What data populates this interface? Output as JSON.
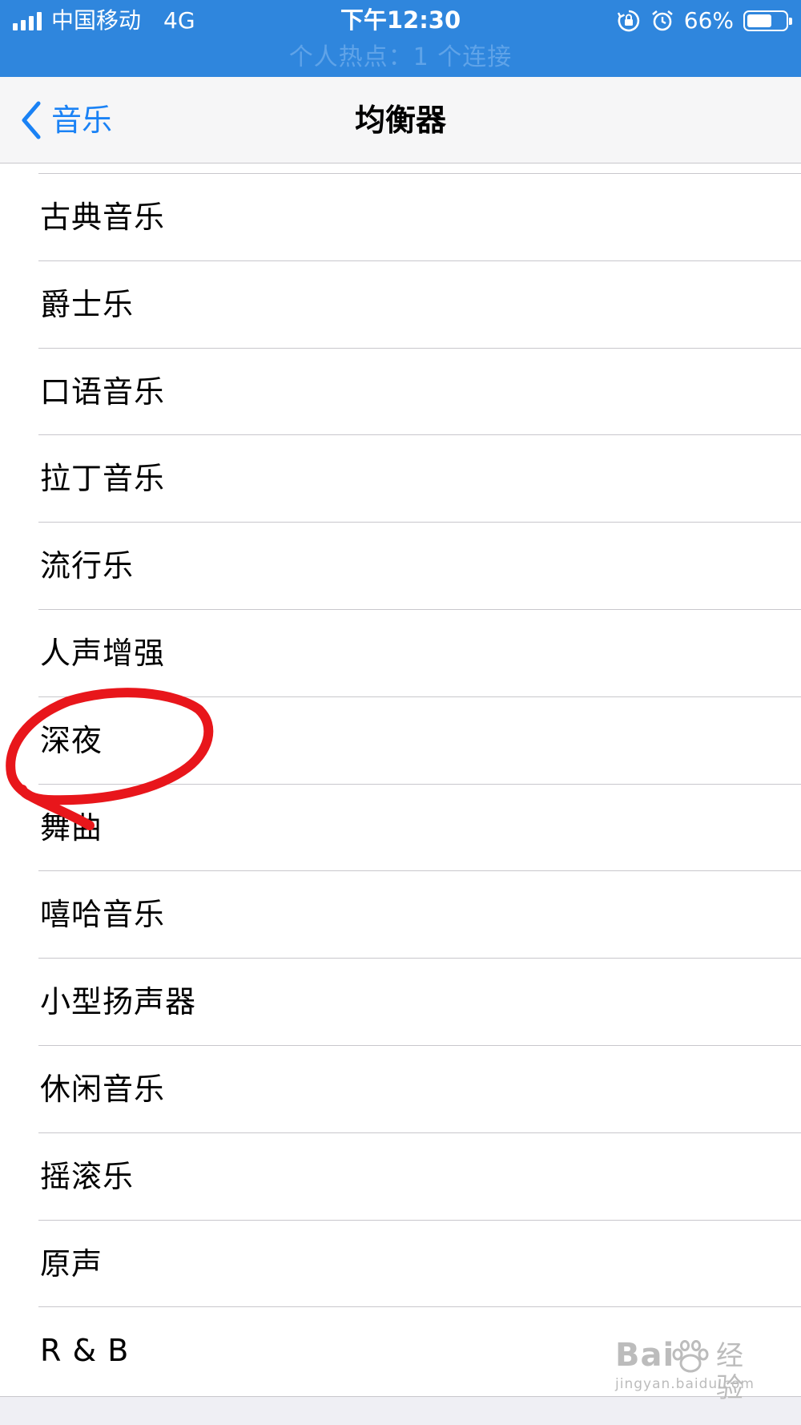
{
  "status_bar": {
    "carrier": "中国移动",
    "network": "4G",
    "time": "下午12:30",
    "battery_percent": "66%",
    "battery_level": 0.66,
    "hotspot_text": "个人热点：1 个连接",
    "icons": [
      "signal-icon",
      "orientation-lock-icon",
      "alarm-icon",
      "battery-icon"
    ],
    "background_color": "#2f86dd"
  },
  "nav": {
    "back_label": "音乐",
    "title": "均衡器",
    "accent_color": "#1a82f5"
  },
  "equalizer_options": [
    {
      "label": "古典音乐"
    },
    {
      "label": "爵士乐"
    },
    {
      "label": "口语音乐"
    },
    {
      "label": "拉丁音乐"
    },
    {
      "label": "流行乐"
    },
    {
      "label": "人声增强"
    },
    {
      "label": "深夜",
      "circled": true
    },
    {
      "label": "舞曲"
    },
    {
      "label": "嘻哈音乐"
    },
    {
      "label": "小型扬声器"
    },
    {
      "label": "休闲音乐"
    },
    {
      "label": "摇滚乐"
    },
    {
      "label": "原声"
    },
    {
      "label": "R & B"
    }
  ],
  "annotation": {
    "color": "#e8161b",
    "target": "深夜"
  },
  "watermark": {
    "brand": "Bai",
    "brand_cn": "经验",
    "url": "jingyan.baidu.com"
  }
}
